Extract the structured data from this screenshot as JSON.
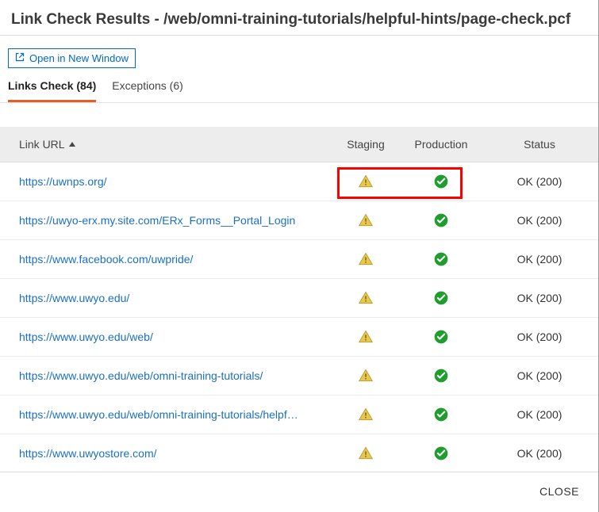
{
  "header": {
    "title": "Link Check Results - /web/omni-training-tutorials/helpful-hints/page-check.pcf"
  },
  "toolbar": {
    "open_new_window": "Open in New Window"
  },
  "tabs": {
    "links": {
      "label": "Links Check",
      "count": 84
    },
    "exceptions": {
      "label": "Exceptions",
      "count": 6
    }
  },
  "table": {
    "headers": {
      "url": "Link URL",
      "staging": "Staging",
      "production": "Production",
      "status": "Status"
    },
    "rows": [
      {
        "url": "https://uwnps.org/",
        "staging": "warn",
        "production": "ok",
        "status": "OK (200)"
      },
      {
        "url": "https://uwyo-erx.my.site.com/ERx_Forms__Portal_Login",
        "staging": "warn",
        "production": "ok",
        "status": "OK (200)"
      },
      {
        "url": "https://www.facebook.com/uwpride/",
        "staging": "warn",
        "production": "ok",
        "status": "OK (200)"
      },
      {
        "url": "https://www.uwyo.edu/",
        "staging": "warn",
        "production": "ok",
        "status": "OK (200)"
      },
      {
        "url": "https://www.uwyo.edu/web/",
        "staging": "warn",
        "production": "ok",
        "status": "OK (200)"
      },
      {
        "url": "https://www.uwyo.edu/web/omni-training-tutorials/",
        "staging": "warn",
        "production": "ok",
        "status": "OK (200)"
      },
      {
        "url": "https://www.uwyo.edu/web/omni-training-tutorials/helpf…",
        "staging": "warn",
        "production": "ok",
        "status": "OK (200)"
      },
      {
        "url": "https://www.uwyostore.com/",
        "staging": "warn",
        "production": "ok",
        "status": "OK (200)"
      }
    ]
  },
  "footer": {
    "close": "CLOSE"
  }
}
